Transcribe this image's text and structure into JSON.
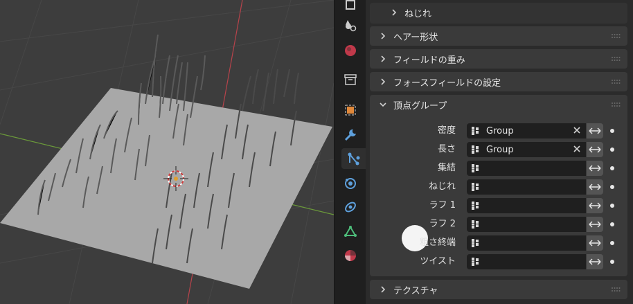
{
  "viewport": {
    "icon": "3d-viewport-hair-particles"
  },
  "tabs": [
    {
      "icon": "render-icon"
    },
    {
      "icon": "scene-icon"
    },
    {
      "icon": "world-icon"
    },
    {
      "icon": "collection-icon"
    },
    {
      "icon": "object-icon"
    },
    {
      "icon": "modifier-wrench-icon"
    },
    {
      "icon": "particles-icon"
    },
    {
      "icon": "physics-icon"
    },
    {
      "icon": "constraints-icon"
    },
    {
      "icon": "data-mesh-icon"
    },
    {
      "icon": "material-icon"
    }
  ],
  "panels": {
    "twist_sub": "ねじれ",
    "hair_shape": "ヘアー形状",
    "field_weights": "フィールドの重み",
    "force_field_settings": "フォースフィールドの設定",
    "vertex_groups": "頂点グループ",
    "texture": "テクスチャ"
  },
  "vertex_groups": {
    "rows": [
      {
        "label": "密度",
        "value": "Group"
      },
      {
        "label": "長さ",
        "value": "Group"
      },
      {
        "label": "集結",
        "value": ""
      },
      {
        "label": "ねじれ",
        "value": ""
      },
      {
        "label": "ラフ 1",
        "value": ""
      },
      {
        "label": "ラフ 2",
        "value": ""
      },
      {
        "label": "粗さ終端",
        "value": ""
      },
      {
        "label": "ツイスト",
        "value": ""
      }
    ]
  },
  "colors": {
    "viewport_bg": "#3d3d3d",
    "panel_bg": "#3a3a3a",
    "field_bg": "#1f1f1f",
    "axis_red": "#b8434b",
    "axis_green": "#6b9a3a",
    "plane": "#a8a8a8"
  }
}
